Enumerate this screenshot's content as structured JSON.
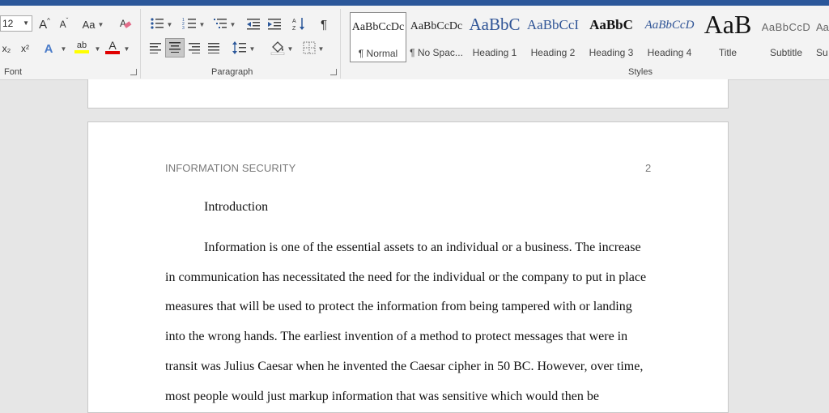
{
  "ribbon": {
    "font": {
      "size_value": "12",
      "label": "Font",
      "grow_glyph": "A",
      "shrink_glyph": "A",
      "case_glyph": "Aa",
      "subscript_glyph": "x₂",
      "superscript_glyph": "x²",
      "effects_glyph": "A",
      "highlight_glyph": "ab",
      "font_color_glyph": "A",
      "highlight_color": "#ffff00",
      "font_color": "#e00000"
    },
    "paragraph": {
      "label": "Paragraph",
      "show_marks_glyph": "¶"
    },
    "styles": {
      "label": "Styles",
      "items": [
        {
          "preview": "AaBbCcDc",
          "name": "¶ Normal"
        },
        {
          "preview": "AaBbCcDc",
          "name": "¶ No Spac..."
        },
        {
          "preview": "AaBbC",
          "name": "Heading 1"
        },
        {
          "preview": "AaBbCcI",
          "name": "Heading 2"
        },
        {
          "preview": "AaBbC",
          "name": "Heading 3"
        },
        {
          "preview": "AaBbCcD",
          "name": "Heading 4"
        },
        {
          "preview": "AaB",
          "name": "Title"
        },
        {
          "preview": "AaBbCcD",
          "name": "Subtitle"
        },
        {
          "preview": "Aa",
          "name": "Su"
        }
      ]
    }
  },
  "document": {
    "running_head": "INFORMATION SECURITY",
    "page_number": "2",
    "heading": "Introduction",
    "lines": [
      "Information is one of the essential assets to an individual or a business.  The increase",
      "in communication has necessitated the need for the individual or the company to put in place",
      "measures that will be used to protect the information from being tampered with or landing",
      "into the wrong hands.  The earliest invention of a method to protect messages that were in",
      "transit was Julius Caesar when he invented the Caesar cipher in 50 BC.  However, over time,",
      "most people would just markup information that was sensitive which would then be"
    ]
  },
  "colors": {
    "brand": "#2b579a",
    "heading1": "#2f5496"
  }
}
